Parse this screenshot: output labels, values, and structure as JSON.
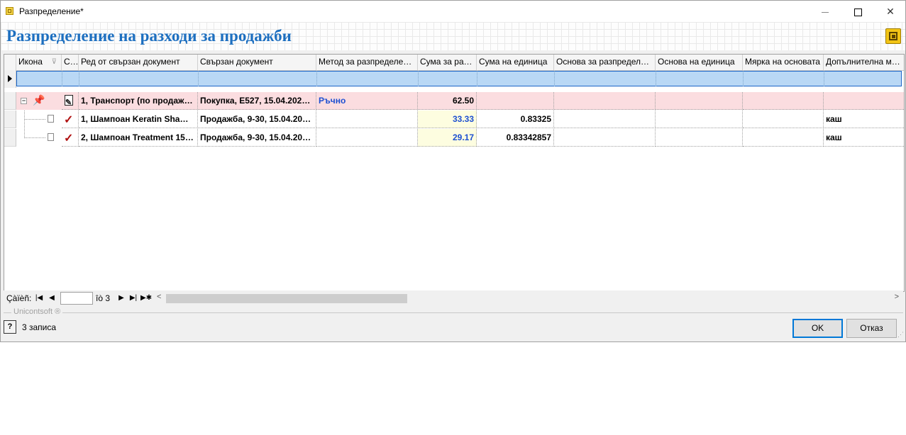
{
  "window": {
    "title": "Разпределение*"
  },
  "header": {
    "heading": "Разпределение на разходи за продажби"
  },
  "grid": {
    "columns": [
      "Икона",
      "С...",
      "Ред от свързан документ",
      "Свързан документ",
      "Метод за разпределение",
      "Сума за раз...",
      "Сума на единица",
      "Основа за разпределяне",
      "Основа на единица",
      "Мярка на основата",
      "Допълнителна мя..."
    ],
    "parent_row": {
      "line": "1, Транспорт (по продажб...",
      "document": "Покупка, E527, 15.04.2024,...",
      "method": "Ръчно",
      "amount": "62.50"
    },
    "child_rows": [
      {
        "line": "1, Шампоан Keratin Shamp...",
        "document": "Продажба, 9-30, 15.04.202...",
        "amount": "33.33",
        "unit_amount": "0.83325",
        "extra_unit": "каш"
      },
      {
        "line": "2, Шампоан Treatment 150...",
        "document": "Продажба, 9-30, 15.04.202...",
        "amount": "29.17",
        "unit_amount": "0.83342857",
        "extra_unit": "каш"
      }
    ]
  },
  "navigator": {
    "label": "Çàïèñ:",
    "of_label": "îò 3",
    "page_value": ""
  },
  "footer": {
    "brand": "Unicontsoft ®",
    "records": "3 записа",
    "ok_label": "OK",
    "cancel_label": "Отказ"
  },
  "icons": {
    "title": "app-icon",
    "logo": "unicontsoft-logo-icon",
    "row_status": [
      "pin-icon",
      "check-icon",
      "check-icon"
    ]
  },
  "colors": {
    "heading": "#1d6fc0",
    "parent_row": "#fbdde0",
    "new_row": "#b9d8f5",
    "link_value": "#1c4fd1",
    "check": "#b01010"
  }
}
